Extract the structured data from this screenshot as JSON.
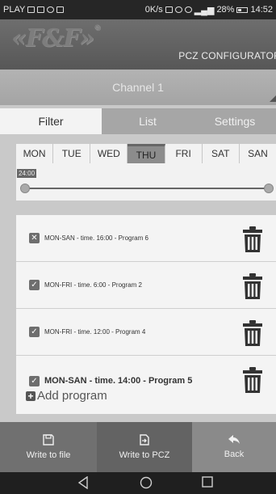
{
  "status_bar": {
    "carrier": "PLAY",
    "net_speed": "0K/s",
    "battery": "28%",
    "time": "14:52",
    "icons": [
      "message-icon",
      "card-icon",
      "whatsapp-icon",
      "gallery-icon",
      "nfc-icon",
      "alarm-icon",
      "mute-icon",
      "signal-icon",
      "battery-icon"
    ]
  },
  "app": {
    "logo_text": "«F&F»",
    "title": "PCZ CONFIGURATOR"
  },
  "channel": {
    "label": "Channel 1"
  },
  "tabs": [
    {
      "label": "Filter",
      "active": true
    },
    {
      "label": "List",
      "active": false
    },
    {
      "label": "Settings",
      "active": false
    }
  ],
  "days": [
    {
      "label": "MON",
      "selected": false
    },
    {
      "label": "TUE",
      "selected": false
    },
    {
      "label": "WED",
      "selected": false
    },
    {
      "label": "THU",
      "selected": true
    },
    {
      "label": "FRI",
      "selected": false
    },
    {
      "label": "SAT",
      "selected": false
    },
    {
      "label": "SAN",
      "selected": false
    }
  ],
  "slider": {
    "time_label": "24:00",
    "range_start_fraction": 0.0,
    "range_end_fraction": 1.0
  },
  "programs": [
    {
      "label": "MON-SAN - time. 16:00 - Program 6",
      "check_glyph": "✕"
    },
    {
      "label": "MON-FRI - time. 6:00 - Program 2",
      "check_glyph": "✓"
    },
    {
      "label": "MON-FRI - time. 12:00 - Program 4",
      "check_glyph": "✓"
    },
    {
      "label": "MON-SAN - time. 14:00 - Program 5",
      "check_glyph": "✓"
    }
  ],
  "add_program": {
    "plus": "+",
    "label": "Add program"
  },
  "actions": [
    {
      "label": "Write to file",
      "icon": "save-icon"
    },
    {
      "label": "Write to PCZ",
      "icon": "export-icon"
    },
    {
      "label": "Back",
      "icon": "back-arrow-icon"
    }
  ],
  "colors": {
    "header_bg": "#575757",
    "selected_day": "#8c8c8c",
    "list_bg": "#f4f4f4",
    "action_bar": "#707070"
  }
}
